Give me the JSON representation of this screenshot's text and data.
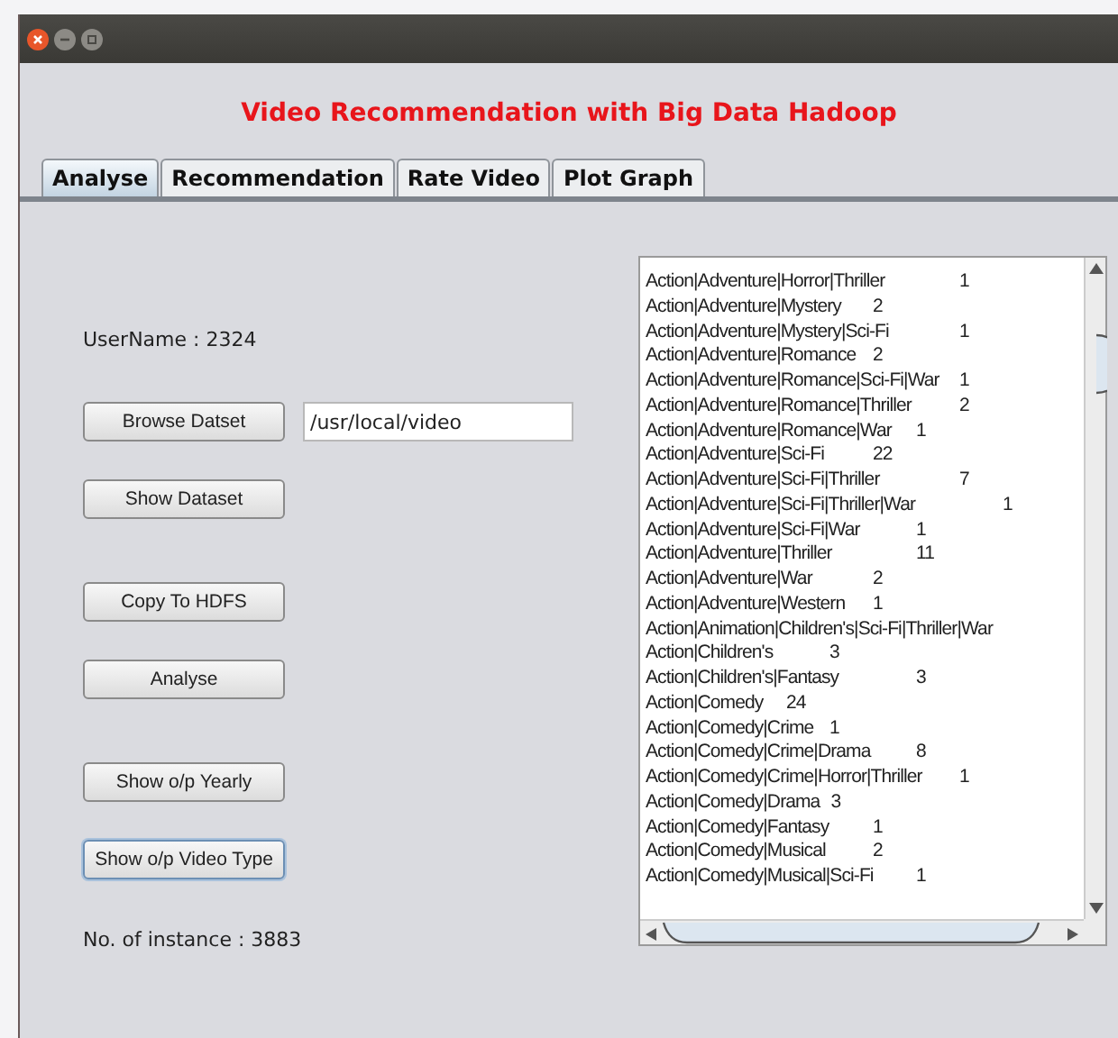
{
  "window": {
    "title": "Video Recommendation with Big Data Hadoop"
  },
  "tabs": [
    {
      "label": "Analyse",
      "selected": true
    },
    {
      "label": "Recommendation",
      "selected": false
    },
    {
      "label": "Rate Video",
      "selected": false
    },
    {
      "label": "Plot Graph",
      "selected": false
    }
  ],
  "user_name": "UserName : 2324",
  "button_groups": [
    [
      {
        "label": "Browse Datset",
        "focused": false,
        "path_field": {
          "value": "/usr/local/video"
        }
      },
      {
        "label": "Show Dataset",
        "focused": false
      }
    ],
    [
      {
        "label": "Copy To HDFS",
        "focused": false
      },
      {
        "label": "Analyse",
        "focused": false
      }
    ],
    [
      {
        "label": "Show o/p Yearly",
        "focused": false
      },
      {
        "label": "Show o/p Video Type",
        "focused": true
      }
    ]
  ],
  "instance_count": "No. of instance : 3883",
  "output_list": [
    {
      "genre": "Action|Adventure|Horror|Thriller",
      "count": "1"
    },
    {
      "genre": "Action|Adventure|Mystery",
      "count": "2"
    },
    {
      "genre": "Action|Adventure|Mystery|Sci-Fi",
      "count": "1"
    },
    {
      "genre": "Action|Adventure|Romance",
      "count": "2"
    },
    {
      "genre": "Action|Adventure|Romance|Sci-Fi|War",
      "count": "1"
    },
    {
      "genre": "Action|Adventure|Romance|Thriller",
      "count": "2"
    },
    {
      "genre": "Action|Adventure|Romance|War",
      "count": "1"
    },
    {
      "genre": "Action|Adventure|Sci-Fi",
      "count": "22"
    },
    {
      "genre": "Action|Adventure|Sci-Fi|Thriller",
      "count": "7"
    },
    {
      "genre": "Action|Adventure|Sci-Fi|Thriller|War",
      "count": "1"
    },
    {
      "genre": "Action|Adventure|Sci-Fi|War",
      "count": "1"
    },
    {
      "genre": "Action|Adventure|Thriller",
      "count": "11"
    },
    {
      "genre": "Action|Adventure|War",
      "count": "2"
    },
    {
      "genre": "Action|Adventure|Western",
      "count": "1"
    },
    {
      "genre": "Action|Animation|Children's|Sci-Fi|Thriller|War"
    },
    {
      "genre": "Action|Children's",
      "count": "3"
    },
    {
      "genre": "Action|Children's|Fantasy",
      "count": "3"
    },
    {
      "genre": "Action|Comedy",
      "count": "24"
    },
    {
      "genre": "Action|Comedy|Crime",
      "count": "1"
    },
    {
      "genre": "Action|Comedy|Crime|Drama",
      "count": "8"
    },
    {
      "genre": "Action|Comedy|Crime|Horror|Thriller",
      "count": "1"
    },
    {
      "genre": "Action|Comedy|Drama",
      "count": "3"
    },
    {
      "genre": "Action|Comedy|Fantasy",
      "count": "1"
    },
    {
      "genre": "Action|Comedy|Musical",
      "count": "2"
    },
    {
      "genre": "Action|Comedy|Musical|Sci-Fi",
      "count": "1"
    }
  ]
}
